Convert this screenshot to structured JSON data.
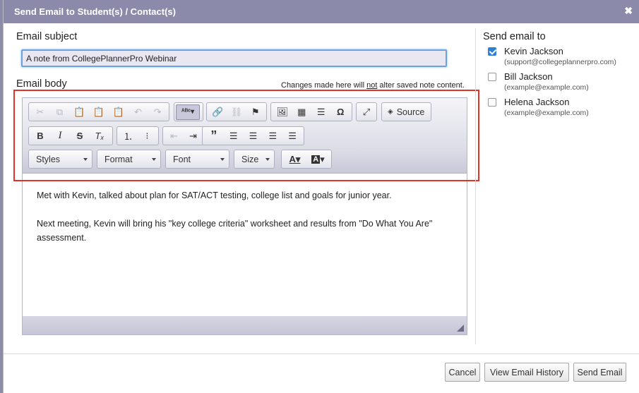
{
  "dialog": {
    "title": "Send Email to Student(s) / Contact(s)",
    "close_icon": "close-icon"
  },
  "subject": {
    "label": "Email subject",
    "value": "A note from CollegePlannerPro Webinar"
  },
  "body": {
    "label": "Email body",
    "note_before": "Changes made here will ",
    "note_emph": "not",
    "note_after": " alter saved note content.",
    "paragraphs": [
      "Met with Kevin, talked about plan for SAT/ACT testing, college list and goals for junior year.",
      "Next meeting, Kevin will bring his \"key college criteria\" worksheet and results from \"Do What You Are\" assessment."
    ]
  },
  "toolbar": {
    "source_label": "Source",
    "styles_label": "Styles",
    "format_label": "Format",
    "font_label": "Font",
    "size_label": "Size"
  },
  "recipients": {
    "heading": "Send email to",
    "list": [
      {
        "name": "Kevin Jackson",
        "email": "(support@collegeplannerpro.com)",
        "checked": true
      },
      {
        "name": "Bill Jackson",
        "email": "(example@example.com)",
        "checked": false
      },
      {
        "name": "Helena Jackson",
        "email": "(example@example.com)",
        "checked": false
      }
    ]
  },
  "footer": {
    "cancel": "Cancel",
    "history": "View Email History",
    "send": "Send Email"
  },
  "colors": {
    "titlebar": "#8b8aab",
    "highlight": "#e2332b",
    "checkbox": "#2f7fd8"
  }
}
